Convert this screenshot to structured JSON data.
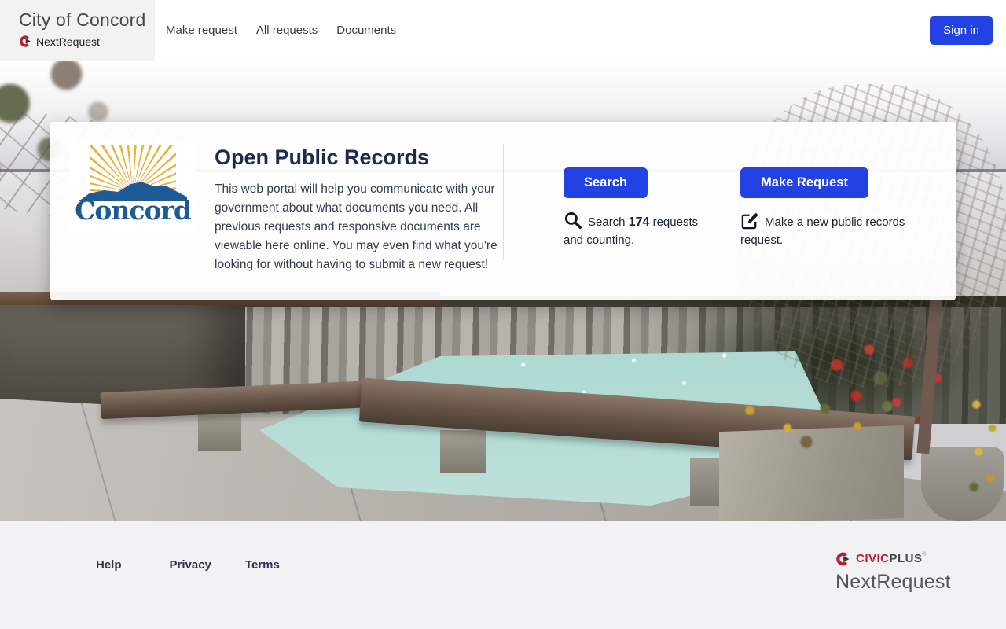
{
  "header": {
    "site_title": "City of Concord",
    "brand": "NextRequest",
    "nav": [
      {
        "label": "Make request"
      },
      {
        "label": "All requests"
      },
      {
        "label": "Documents"
      }
    ],
    "sign_in_label": "Sign in"
  },
  "hero": {
    "logo_text": "Concord",
    "title": "Open Public Records",
    "description": "This web portal will help you communicate with your government about what documents you need. All previous requests and responsive documents are viewable here online. You may even find what you're looking for without having to submit a new request!",
    "search": {
      "button_label": "Search",
      "info_prefix": "Search",
      "count": "174",
      "info_suffix": "requests and counting."
    },
    "make_request": {
      "button_label": "Make Request",
      "info": "Make a new public records request."
    }
  },
  "footer": {
    "links": [
      {
        "label": "Help"
      },
      {
        "label": "Privacy"
      },
      {
        "label": "Terms"
      }
    ],
    "civicplus_civic": "CIVIC",
    "civicplus_plus": "PLUS",
    "civicplus_reg": "®",
    "brand": "NextRequest"
  },
  "colors": {
    "accent_blue": "#2342e4",
    "concord_blue": "#1e5a96",
    "sun_gold": "#e5b23c",
    "civicplus_red": "#bb2030",
    "footer_bg": "#f2f2f4"
  }
}
